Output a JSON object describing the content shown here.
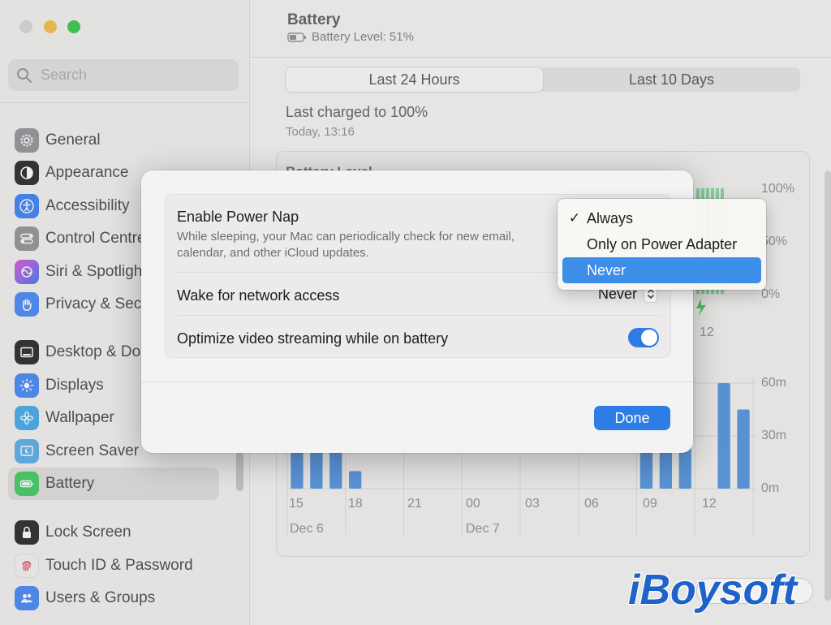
{
  "window": {
    "traffic_lights": [
      "close",
      "minimize",
      "maximize"
    ]
  },
  "sidebar": {
    "search_placeholder": "Search",
    "items": [
      {
        "label": "General",
        "icon": "gear-icon",
        "color": "#8e8e93"
      },
      {
        "label": "Appearance",
        "icon": "appearance-icon",
        "color": "#1c1c1e"
      },
      {
        "label": "Accessibility",
        "icon": "accessibility-icon",
        "color": "#2f7bf5"
      },
      {
        "label": "Control Centre",
        "icon": "control-centre-icon",
        "color": "#8e8e93"
      },
      {
        "label": "Siri & Spotlight",
        "icon": "siri-icon",
        "color": "#b247e8"
      },
      {
        "label": "Privacy & Security",
        "icon": "hand-icon",
        "color": "#3c82f6"
      },
      {
        "label": "Desktop & Dock",
        "icon": "desktop-icon",
        "color": "#1c1c1e"
      },
      {
        "label": "Displays",
        "icon": "sun-icon",
        "color": "#3b82f6"
      },
      {
        "label": "Wallpaper",
        "icon": "flower-icon",
        "color": "#39a7e8"
      },
      {
        "label": "Screen Saver",
        "icon": "screensaver-icon",
        "color": "#4fa9ea"
      },
      {
        "label": "Battery",
        "icon": "battery-icon",
        "color": "#35c759"
      },
      {
        "label": "Lock Screen",
        "icon": "lock-icon",
        "color": "#1c1c1e"
      },
      {
        "label": "Touch ID & Password",
        "icon": "fingerprint-icon",
        "color": "#f2f2f2"
      },
      {
        "label": "Users & Groups",
        "icon": "users-icon",
        "color": "#3b82f6"
      }
    ]
  },
  "main": {
    "title": "Battery",
    "battery_level_text": "Battery Level: 51%",
    "tabs": [
      {
        "label": "Last 24 Hours",
        "selected": true
      },
      {
        "label": "Last 10 Days",
        "selected": false
      }
    ],
    "last_charged": "Last charged to 100%",
    "last_charged_date": "Today, 13:16",
    "chart_heading": "Battery Level",
    "level_axis": [
      "100%",
      "50%",
      "0%"
    ],
    "usage_axis": [
      "60m",
      "30m",
      "0m"
    ],
    "time_ticks": [
      "15",
      "18",
      "21",
      "00",
      "03",
      "06",
      "09",
      "12"
    ],
    "date_labels": [
      "Dec 6",
      "Dec 7"
    ],
    "upper_tick": "12"
  },
  "chart_data": {
    "type": "bar",
    "title": "",
    "ylabel": "",
    "categories": [
      "15",
      "16",
      "17",
      "18",
      "19",
      "20",
      "21",
      "22",
      "23",
      "00",
      "01",
      "02",
      "03",
      "04",
      "05",
      "06",
      "07",
      "08",
      "09",
      "10",
      "11",
      "12",
      "13",
      "14"
    ],
    "values": [
      40,
      40,
      40,
      10,
      0,
      0,
      0,
      0,
      0,
      0,
      0,
      0,
      0,
      0,
      0,
      0,
      0,
      0,
      45,
      45,
      50,
      0,
      60,
      45
    ],
    "ylim": [
      0,
      60
    ]
  },
  "dialog": {
    "power_nap_title": "Enable Power Nap",
    "power_nap_desc": "While sleeping, your Mac can periodically check for new email, calendar, and other iCloud updates.",
    "wake_label": "Wake for network access",
    "wake_value": "Never",
    "optimize_label": "Optimize video streaming while on battery",
    "optimize_on": true,
    "done_label": "Done"
  },
  "popup": {
    "options": [
      {
        "label": "Always",
        "checked": true,
        "highlighted": false
      },
      {
        "label": "Only on Power Adapter",
        "checked": false,
        "highlighted": false
      },
      {
        "label": "Never",
        "checked": false,
        "highlighted": true
      }
    ]
  },
  "colors": {
    "accent": "#2e7de6",
    "bar": "#4a8fe0",
    "charging_green": "#35c759"
  }
}
